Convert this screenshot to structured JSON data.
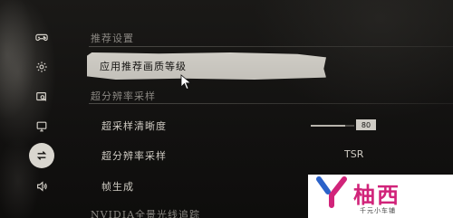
{
  "sidebar": {
    "items": [
      {
        "icon": "gamepad-icon"
      },
      {
        "icon": "gear-icon"
      },
      {
        "icon": "display-search-icon"
      },
      {
        "icon": "monitor-icon"
      },
      {
        "icon": "swap-arrows-icon",
        "active": true
      },
      {
        "icon": "speaker-icon"
      }
    ]
  },
  "recommended": {
    "section_title": "推荐设置",
    "apply_button_label": "应用推荐画质等级"
  },
  "super_resolution": {
    "section_title": "超分辨率采样",
    "rows": {
      "clarity_label": "超采样清晰度",
      "clarity_value": "80",
      "clarity_fraction": 0.8,
      "sampling_label": "超分辨率采样",
      "sampling_value": "TSR",
      "frame_gen_label": "帧生成"
    }
  },
  "nvidia": {
    "section_title": "NVIDIA全景光线追踪"
  },
  "watermark": {
    "title": "柚西",
    "subtitle": "千元小车铺"
  },
  "colors": {
    "accent_pink": "#d1247a",
    "accent_blue": "#2b62c9",
    "brush_button": "#cfccc5",
    "background": "#141311"
  }
}
